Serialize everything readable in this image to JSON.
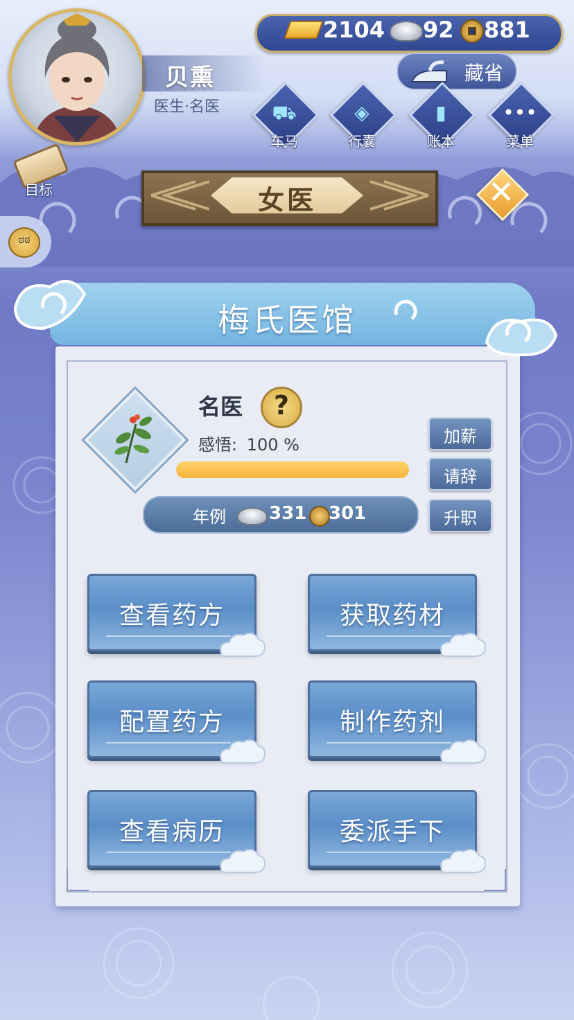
{
  "player": {
    "name": "贝熏",
    "title": "医生·名医"
  },
  "currency": {
    "gold": "2104",
    "silver": "92",
    "copper": "881"
  },
  "hide_button": {
    "label": "藏省"
  },
  "menu": [
    {
      "label": "车马",
      "icon": "carriage-icon"
    },
    {
      "label": "行囊",
      "icon": "bag-icon"
    },
    {
      "label": "账本",
      "icon": "ledger-icon"
    },
    {
      "label": "菜单",
      "icon": "more-icon"
    }
  ],
  "goal_button": {
    "label": "目标"
  },
  "page_title": "女医",
  "hospital_name": "梅氏医馆",
  "job": {
    "rank": "名医",
    "insight_label": "感悟:",
    "insight_value": "100 %",
    "insight_progress": 1.0,
    "salary_label": "年例",
    "salary_silver": "331",
    "salary_copper": "301"
  },
  "side_actions": {
    "raise": "加薪",
    "resign": "请辞",
    "promote": "升职"
  },
  "actions": [
    "查看药方",
    "获取药材",
    "配置药方",
    "制作药剂",
    "查看病历",
    "委派手下"
  ],
  "colors": {
    "progress": "#f3b33a",
    "accent_gold": "#d9b663",
    "panel": "#e9ecf5"
  }
}
